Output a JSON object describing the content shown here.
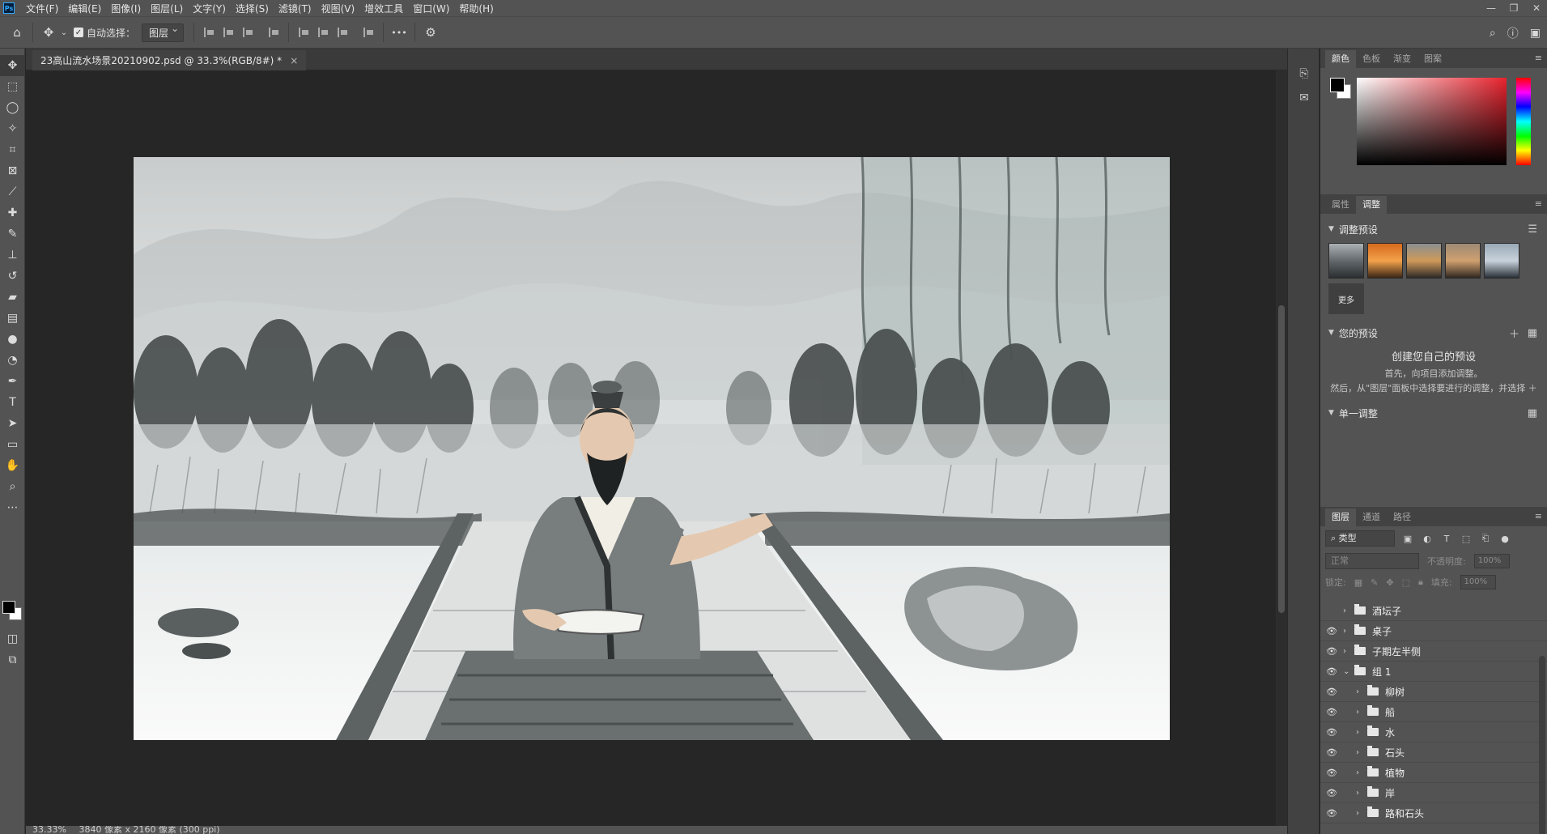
{
  "menubar": {
    "logo": "Ps",
    "items": [
      "文件(F)",
      "编辑(E)",
      "图像(I)",
      "图层(L)",
      "文字(Y)",
      "选择(S)",
      "滤镜(T)",
      "视图(V)",
      "增效工具",
      "窗口(W)",
      "帮助(H)"
    ]
  },
  "window_controls": {
    "minimize": "—",
    "restore": "❐",
    "close": "✕"
  },
  "options": {
    "auto_select_label": "自动选择：",
    "auto_select_target": "图层",
    "more_label": "•••"
  },
  "document": {
    "tab_title": "23高山流水场景20210902.psd @ 33.3%(RGB/8#) *",
    "close_glyph": "×"
  },
  "status": {
    "zoom": "33.33%",
    "doc_info": "3840 像素 x 2160 像素 (300 ppi)"
  },
  "color_panel": {
    "tabs": [
      "颜色",
      "色板",
      "渐变",
      "图案"
    ],
    "active_tab": 0
  },
  "adjust_panel": {
    "tabs": [
      "属性",
      "调整"
    ],
    "active_tab": 1,
    "presets_header": "调整预设",
    "more_label": "更多",
    "your_presets_header": "您的预设",
    "create_title": "创建您自己的预设",
    "create_line1": "首先，向项目添加调整。",
    "create_line2": "然后，从\"图层\"面板中选择要进行的调整，并选择 ＋",
    "single_adjust_header": "单一调整"
  },
  "layers_panel": {
    "tabs": [
      "图层",
      "通道",
      "路径"
    ],
    "active_tab": 0,
    "filter_label": "类型",
    "blend_mode": "正常",
    "opacity_label": "不透明度:",
    "opacity_value": "100%",
    "lock_label": "锁定:",
    "fill_label": "填充:",
    "fill_value": "100%",
    "layers": [
      {
        "name": "酒坛子",
        "visible": false,
        "expanded": false,
        "indent": false
      },
      {
        "name": "桌子",
        "visible": true,
        "expanded": false,
        "indent": false
      },
      {
        "name": "子期左半侧",
        "visible": true,
        "expanded": false,
        "indent": false
      },
      {
        "name": "组 1",
        "visible": true,
        "expanded": true,
        "indent": false
      },
      {
        "name": "柳树",
        "visible": true,
        "expanded": false,
        "indent": true
      },
      {
        "name": "船",
        "visible": true,
        "expanded": false,
        "indent": true
      },
      {
        "name": "水",
        "visible": true,
        "expanded": false,
        "indent": true
      },
      {
        "name": "石头",
        "visible": true,
        "expanded": false,
        "indent": true
      },
      {
        "name": "植物",
        "visible": true,
        "expanded": false,
        "indent": true
      },
      {
        "name": "岸",
        "visible": true,
        "expanded": false,
        "indent": true
      },
      {
        "name": "路和石头",
        "visible": true,
        "expanded": false,
        "indent": true
      }
    ]
  }
}
